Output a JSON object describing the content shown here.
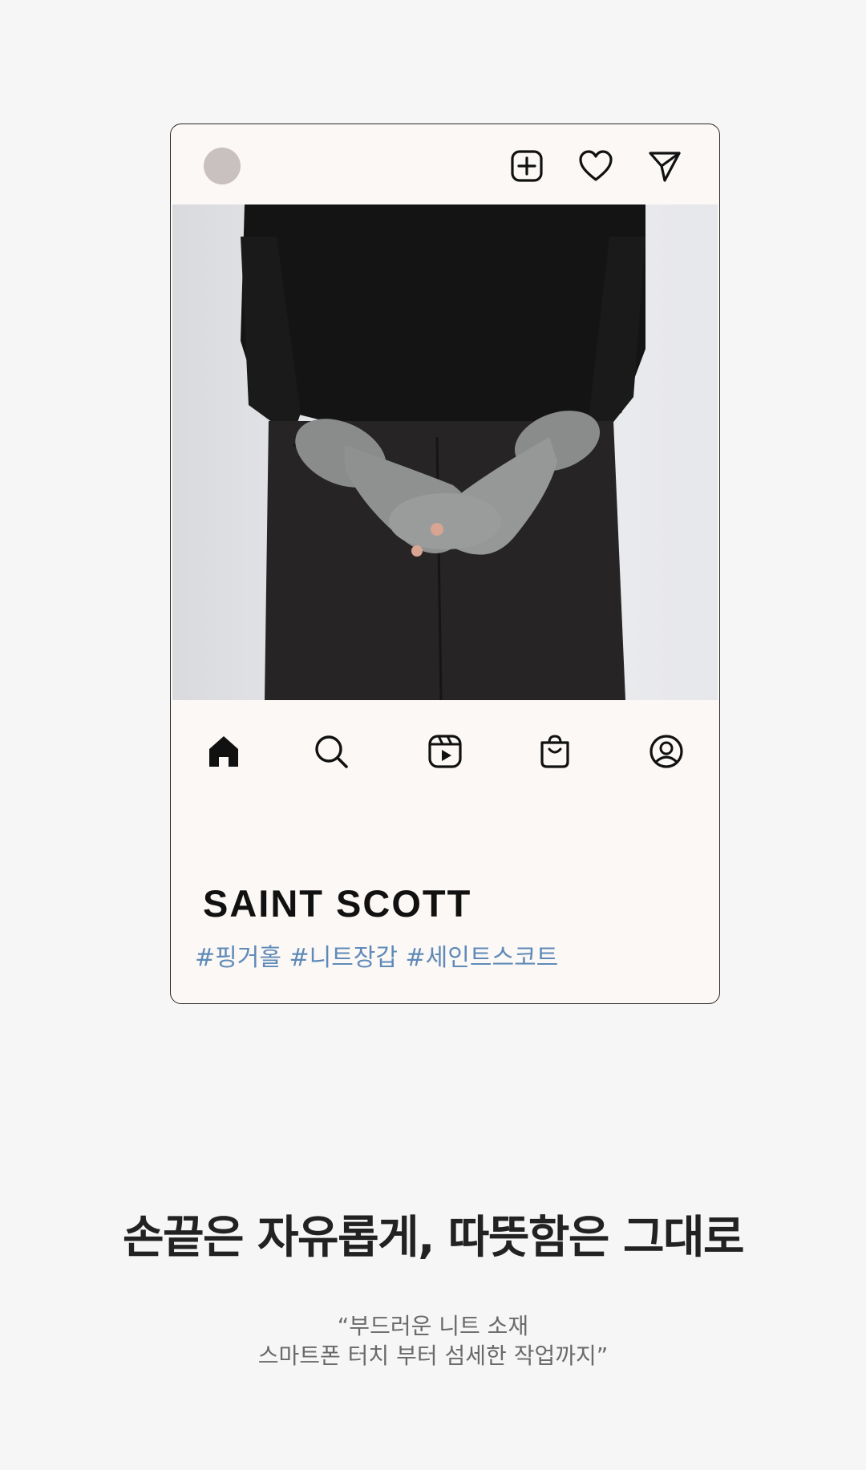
{
  "post_card": {
    "top_icons": [
      "avatar",
      "add-square-icon",
      "heart-icon",
      "send-icon"
    ],
    "photo_subject": "",
    "nav_icons": [
      "home-icon",
      "search-icon",
      "reels-icon",
      "shop-bag-icon",
      "profile-icon"
    ],
    "brand": "SAINT SCOTT",
    "hashtags": "#핑거홀 #니트장갑 #세인트스코트"
  },
  "headline": "손끝은 자유롭게, 따뜻함은 그대로",
  "quote": {
    "line1": "“부드러운 니트 소재",
    "line2": "스마트폰 터치 부터 섬세한 작업까지”"
  },
  "colors": {
    "page_bg": "#f6f6f6",
    "card_bg": "#fbf8f5",
    "hashtag": "#5f8ab8",
    "avatar": "#c9c0c0"
  }
}
